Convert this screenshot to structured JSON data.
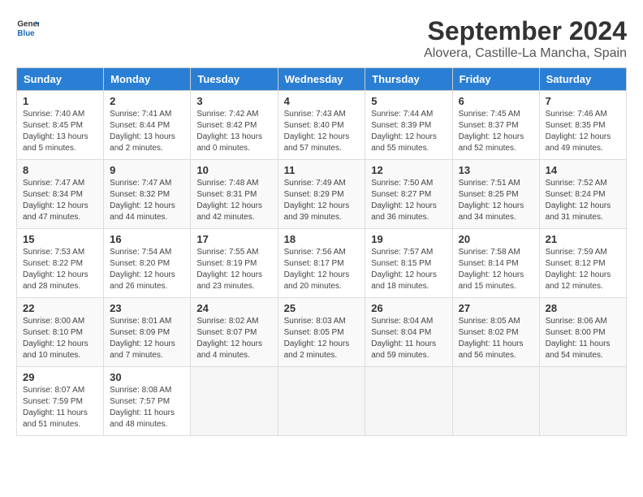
{
  "logo": {
    "general": "General",
    "blue": "Blue"
  },
  "title": "September 2024",
  "subtitle": "Alovera, Castille-La Mancha, Spain",
  "days_of_week": [
    "Sunday",
    "Monday",
    "Tuesday",
    "Wednesday",
    "Thursday",
    "Friday",
    "Saturday"
  ],
  "weeks": [
    [
      {
        "day": "1",
        "sunrise": "Sunrise: 7:40 AM",
        "sunset": "Sunset: 8:45 PM",
        "daylight": "Daylight: 13 hours and 5 minutes."
      },
      {
        "day": "2",
        "sunrise": "Sunrise: 7:41 AM",
        "sunset": "Sunset: 8:44 PM",
        "daylight": "Daylight: 13 hours and 2 minutes."
      },
      {
        "day": "3",
        "sunrise": "Sunrise: 7:42 AM",
        "sunset": "Sunset: 8:42 PM",
        "daylight": "Daylight: 13 hours and 0 minutes."
      },
      {
        "day": "4",
        "sunrise": "Sunrise: 7:43 AM",
        "sunset": "Sunset: 8:40 PM",
        "daylight": "Daylight: 12 hours and 57 minutes."
      },
      {
        "day": "5",
        "sunrise": "Sunrise: 7:44 AM",
        "sunset": "Sunset: 8:39 PM",
        "daylight": "Daylight: 12 hours and 55 minutes."
      },
      {
        "day": "6",
        "sunrise": "Sunrise: 7:45 AM",
        "sunset": "Sunset: 8:37 PM",
        "daylight": "Daylight: 12 hours and 52 minutes."
      },
      {
        "day": "7",
        "sunrise": "Sunrise: 7:46 AM",
        "sunset": "Sunset: 8:35 PM",
        "daylight": "Daylight: 12 hours and 49 minutes."
      }
    ],
    [
      {
        "day": "8",
        "sunrise": "Sunrise: 7:47 AM",
        "sunset": "Sunset: 8:34 PM",
        "daylight": "Daylight: 12 hours and 47 minutes."
      },
      {
        "day": "9",
        "sunrise": "Sunrise: 7:47 AM",
        "sunset": "Sunset: 8:32 PM",
        "daylight": "Daylight: 12 hours and 44 minutes."
      },
      {
        "day": "10",
        "sunrise": "Sunrise: 7:48 AM",
        "sunset": "Sunset: 8:31 PM",
        "daylight": "Daylight: 12 hours and 42 minutes."
      },
      {
        "day": "11",
        "sunrise": "Sunrise: 7:49 AM",
        "sunset": "Sunset: 8:29 PM",
        "daylight": "Daylight: 12 hours and 39 minutes."
      },
      {
        "day": "12",
        "sunrise": "Sunrise: 7:50 AM",
        "sunset": "Sunset: 8:27 PM",
        "daylight": "Daylight: 12 hours and 36 minutes."
      },
      {
        "day": "13",
        "sunrise": "Sunrise: 7:51 AM",
        "sunset": "Sunset: 8:25 PM",
        "daylight": "Daylight: 12 hours and 34 minutes."
      },
      {
        "day": "14",
        "sunrise": "Sunrise: 7:52 AM",
        "sunset": "Sunset: 8:24 PM",
        "daylight": "Daylight: 12 hours and 31 minutes."
      }
    ],
    [
      {
        "day": "15",
        "sunrise": "Sunrise: 7:53 AM",
        "sunset": "Sunset: 8:22 PM",
        "daylight": "Daylight: 12 hours and 28 minutes."
      },
      {
        "day": "16",
        "sunrise": "Sunrise: 7:54 AM",
        "sunset": "Sunset: 8:20 PM",
        "daylight": "Daylight: 12 hours and 26 minutes."
      },
      {
        "day": "17",
        "sunrise": "Sunrise: 7:55 AM",
        "sunset": "Sunset: 8:19 PM",
        "daylight": "Daylight: 12 hours and 23 minutes."
      },
      {
        "day": "18",
        "sunrise": "Sunrise: 7:56 AM",
        "sunset": "Sunset: 8:17 PM",
        "daylight": "Daylight: 12 hours and 20 minutes."
      },
      {
        "day": "19",
        "sunrise": "Sunrise: 7:57 AM",
        "sunset": "Sunset: 8:15 PM",
        "daylight": "Daylight: 12 hours and 18 minutes."
      },
      {
        "day": "20",
        "sunrise": "Sunrise: 7:58 AM",
        "sunset": "Sunset: 8:14 PM",
        "daylight": "Daylight: 12 hours and 15 minutes."
      },
      {
        "day": "21",
        "sunrise": "Sunrise: 7:59 AM",
        "sunset": "Sunset: 8:12 PM",
        "daylight": "Daylight: 12 hours and 12 minutes."
      }
    ],
    [
      {
        "day": "22",
        "sunrise": "Sunrise: 8:00 AM",
        "sunset": "Sunset: 8:10 PM",
        "daylight": "Daylight: 12 hours and 10 minutes."
      },
      {
        "day": "23",
        "sunrise": "Sunrise: 8:01 AM",
        "sunset": "Sunset: 8:09 PM",
        "daylight": "Daylight: 12 hours and 7 minutes."
      },
      {
        "day": "24",
        "sunrise": "Sunrise: 8:02 AM",
        "sunset": "Sunset: 8:07 PM",
        "daylight": "Daylight: 12 hours and 4 minutes."
      },
      {
        "day": "25",
        "sunrise": "Sunrise: 8:03 AM",
        "sunset": "Sunset: 8:05 PM",
        "daylight": "Daylight: 12 hours and 2 minutes."
      },
      {
        "day": "26",
        "sunrise": "Sunrise: 8:04 AM",
        "sunset": "Sunset: 8:04 PM",
        "daylight": "Daylight: 11 hours and 59 minutes."
      },
      {
        "day": "27",
        "sunrise": "Sunrise: 8:05 AM",
        "sunset": "Sunset: 8:02 PM",
        "daylight": "Daylight: 11 hours and 56 minutes."
      },
      {
        "day": "28",
        "sunrise": "Sunrise: 8:06 AM",
        "sunset": "Sunset: 8:00 PM",
        "daylight": "Daylight: 11 hours and 54 minutes."
      }
    ],
    [
      {
        "day": "29",
        "sunrise": "Sunrise: 8:07 AM",
        "sunset": "Sunset: 7:59 PM",
        "daylight": "Daylight: 11 hours and 51 minutes."
      },
      {
        "day": "30",
        "sunrise": "Sunrise: 8:08 AM",
        "sunset": "Sunset: 7:57 PM",
        "daylight": "Daylight: 11 hours and 48 minutes."
      },
      null,
      null,
      null,
      null,
      null
    ]
  ]
}
